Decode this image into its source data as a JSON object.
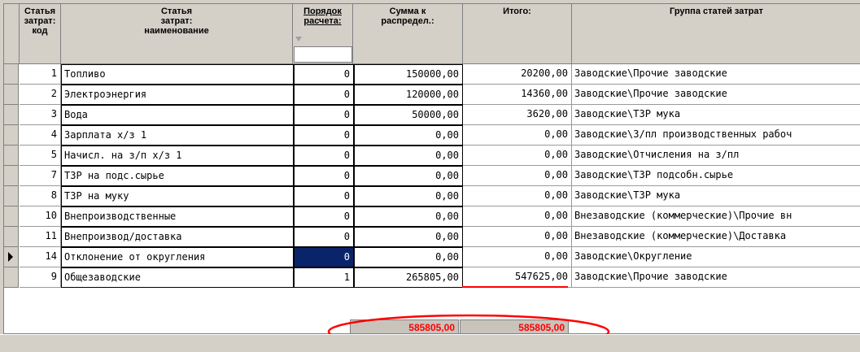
{
  "columns": [
    {
      "title": "Статья",
      "sub1": "затрат:",
      "sub2": "код"
    },
    {
      "title": "Статья",
      "sub1": "затрат:",
      "sub2": "наименование"
    },
    {
      "title": "Порядок",
      "sub1": "расчета:",
      "sub2": ""
    },
    {
      "title": "Сумма к",
      "sub1": "распредел.:",
      "sub2": ""
    },
    {
      "title": "Итого:",
      "sub1": "",
      "sub2": ""
    },
    {
      "title": "Группа статей затрат",
      "sub1": "",
      "sub2": ""
    }
  ],
  "rows": [
    {
      "code": "1",
      "name": "Топливо",
      "order": "0",
      "amount": "150000,00",
      "total": "20200,00",
      "group": "Заводские\\Прочие заводские"
    },
    {
      "code": "2",
      "name": "Электроэнергия",
      "order": "0",
      "amount": "120000,00",
      "total": "14360,00",
      "group": "Заводские\\Прочие заводские"
    },
    {
      "code": "3",
      "name": "Вода",
      "order": "0",
      "amount": "50000,00",
      "total": "3620,00",
      "group": "Заводские\\ТЗР мука"
    },
    {
      "code": "4",
      "name": "Зарплата х/з 1",
      "order": "0",
      "amount": "0,00",
      "total": "0,00",
      "group": "Заводские\\З/пл производственных рабоч"
    },
    {
      "code": "5",
      "name": "Начисл. на з/п х/з 1",
      "order": "0",
      "amount": "0,00",
      "total": "0,00",
      "group": "Заводские\\Отчисления на з/пл"
    },
    {
      "code": "7",
      "name": "ТЗР на подс.сырье",
      "order": "0",
      "amount": "0,00",
      "total": "0,00",
      "group": "Заводские\\ТЗР подсобн.сырье"
    },
    {
      "code": "8",
      "name": "ТЗР на муку",
      "order": "0",
      "amount": "0,00",
      "total": "0,00",
      "group": "Заводские\\ТЗР мука"
    },
    {
      "code": "10",
      "name": "Внепроизводственные",
      "order": "0",
      "amount": "0,00",
      "total": "0,00",
      "group": "Внезаводские (коммерческие)\\Прочие вн"
    },
    {
      "code": "11",
      "name": "Внепроизвод/доставка",
      "order": "0",
      "amount": "0,00",
      "total": "0,00",
      "group": "Внезаводские (коммерческие)\\Доставка"
    },
    {
      "code": "14",
      "name": "Отклонение от округления",
      "order": "0",
      "amount": "0,00",
      "total": "0,00",
      "group": "Заводские\\Округление"
    },
    {
      "code": "9",
      "name": "Общезаводские",
      "order": "1",
      "amount": "265805,00",
      "total": "547625,00",
      "group": "Заводские\\Прочие заводские"
    }
  ],
  "current_row_index": 9,
  "totals": {
    "amount": "585805,00",
    "total": "585805,00"
  },
  "colors": {
    "annotation": "#ff0000",
    "selection": "#0a246a",
    "total_text": "#ff0000"
  }
}
